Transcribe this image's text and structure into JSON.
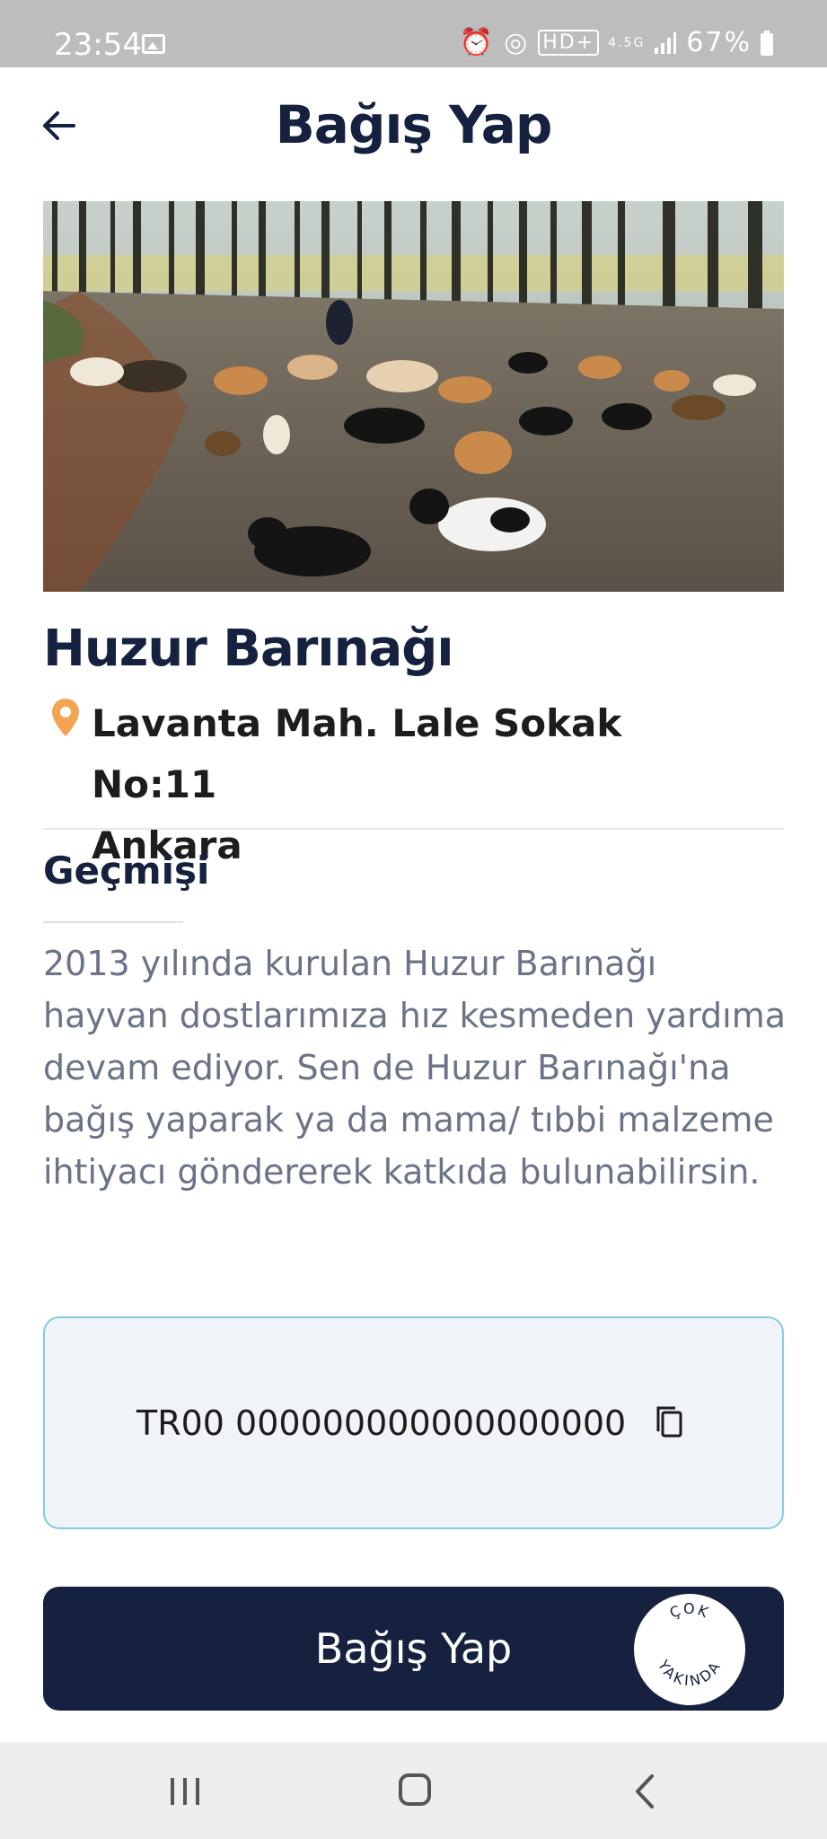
{
  "status_bar": {
    "time": "23:54",
    "icons": [
      "gallery-icon",
      "alarm-icon",
      "hotspot-icon",
      "hd-icon",
      "4g-icon",
      "signal-icon",
      "battery-icon"
    ],
    "network_label": "4.5G",
    "battery": "67%"
  },
  "header": {
    "title": "Bağış Yap",
    "back_icon": "arrow-left-icon"
  },
  "shelter": {
    "name": "Huzur Barınağı",
    "address_line1": "Lavanta Mah. Lale Sokak No:11",
    "address_line2": "Ankara"
  },
  "history": {
    "title": "Geçmişi",
    "text": "2013 yılında kurulan Huzur Barınağı hayvan dostlarımıza hız kesmeden yardıma devam ediyor. Sen de Huzur Barınağı'na bağış yaparak ya da mama/ tıbbi malzeme ihtiyacı göndererek katkıda bulunabilirsin."
  },
  "iban": {
    "value": "TR00 000000000000000000"
  },
  "donate_button": {
    "label": "Bağış Yap",
    "badge_top": "ÇOK",
    "badge_bottom": "YAKINDA"
  },
  "nav": [
    "recent-apps-icon",
    "home-icon",
    "back-icon"
  ],
  "colors": {
    "primary": "#15213f",
    "accent_pin": "#f4a451",
    "iban_border": "#88cbe0",
    "iban_bg": "#f0f3f7"
  }
}
